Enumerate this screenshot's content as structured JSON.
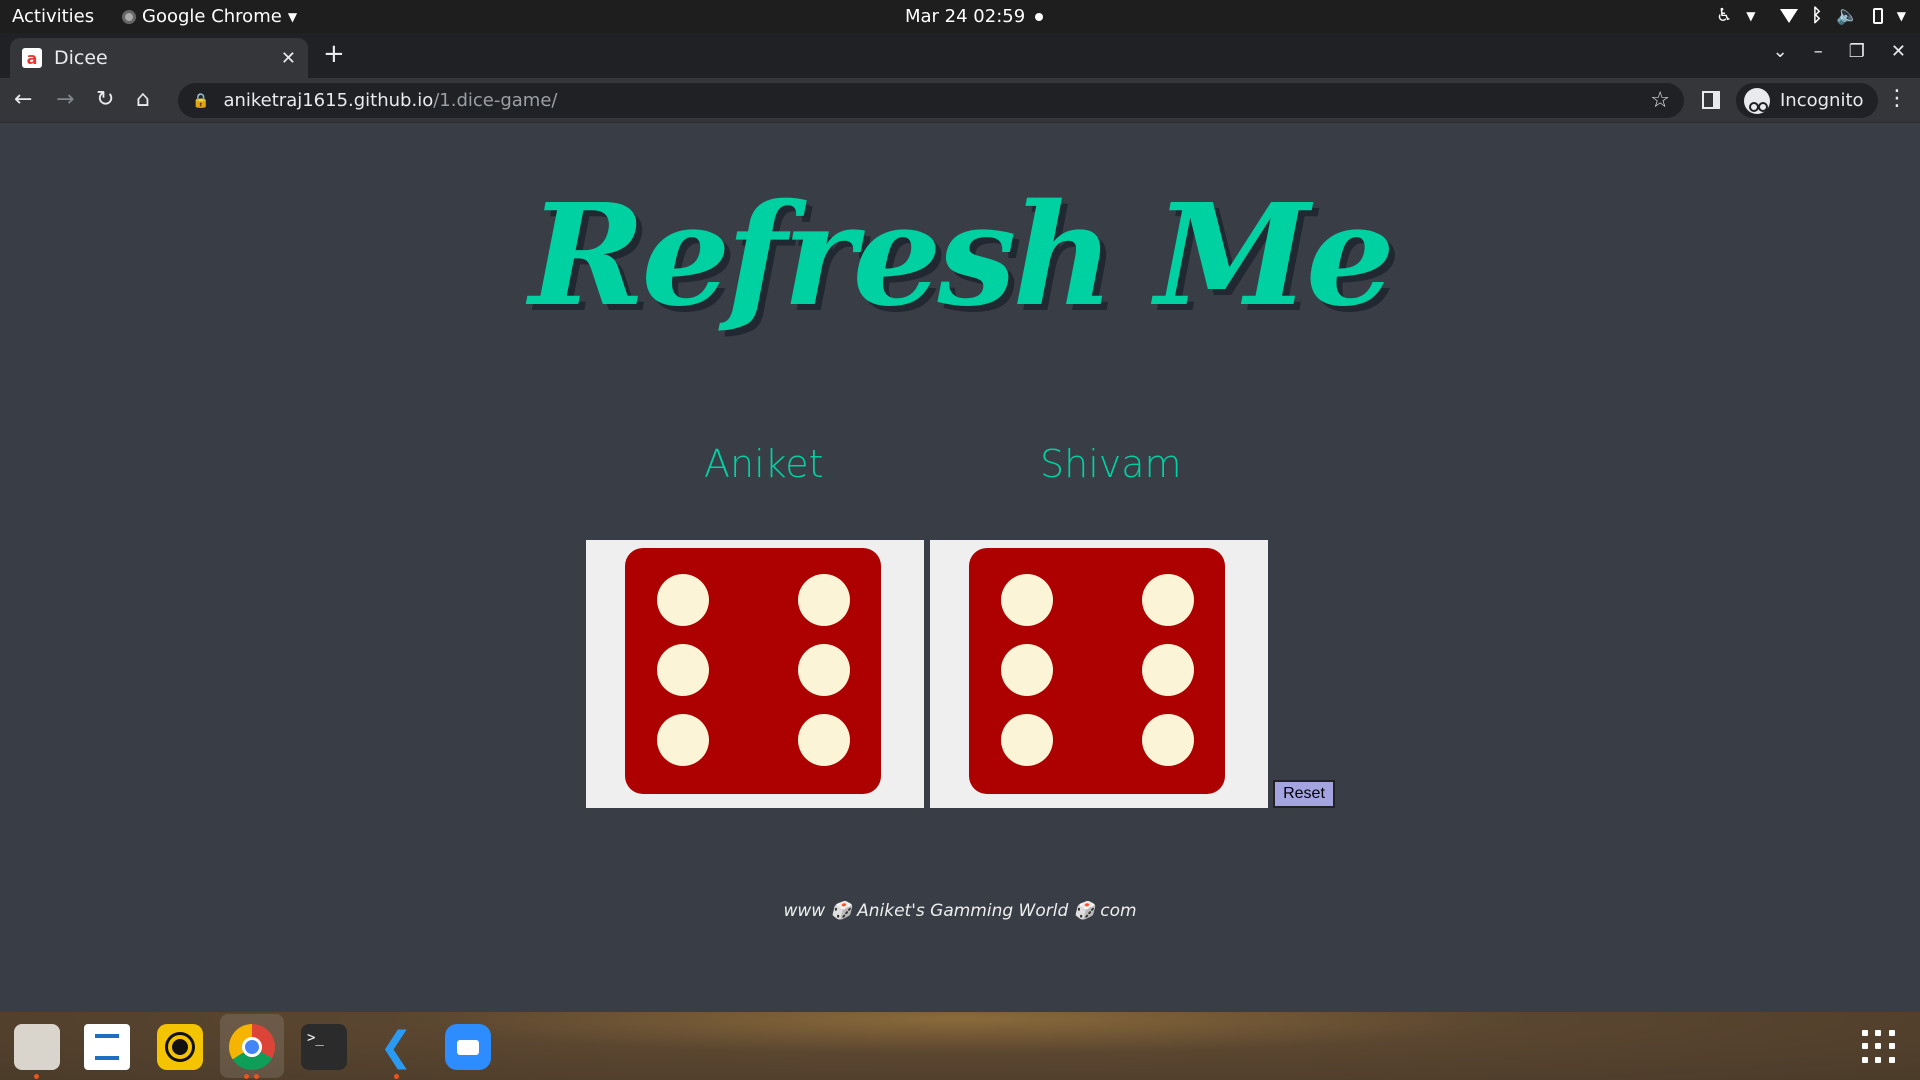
{
  "topbar": {
    "activities": "Activities",
    "app_name": "Google Chrome",
    "clock": "Mar 24  02:59",
    "tray_icons": [
      "accessibility-icon",
      "wifi-icon",
      "bluetooth-icon",
      "volume-icon",
      "battery-icon"
    ]
  },
  "browser": {
    "tab_title": "Dicee",
    "tab_favicon": "a",
    "new_tab": "+",
    "url_host": "aniketraj1615.github.io",
    "url_path": "/1.dice-game/",
    "profile_label": "Incognito"
  },
  "page": {
    "heading": "Refresh Me",
    "player1": "Aniket",
    "player2": "Shivam",
    "die1_value": 6,
    "die2_value": 6,
    "reset_label": "Reset",
    "footer": "www 🎲 Aniket's Gamming World 🎲 com"
  },
  "colors": {
    "page_bg": "#393e46",
    "accent": "#00d1a2",
    "die_red": "#ad0000",
    "pip": "#fbf4d6"
  },
  "dock": {
    "apps": [
      "files-icon",
      "text-editor-icon",
      "rhythmbox-icon",
      "chrome-icon",
      "terminal-icon",
      "vscode-icon",
      "zoom-icon"
    ]
  }
}
